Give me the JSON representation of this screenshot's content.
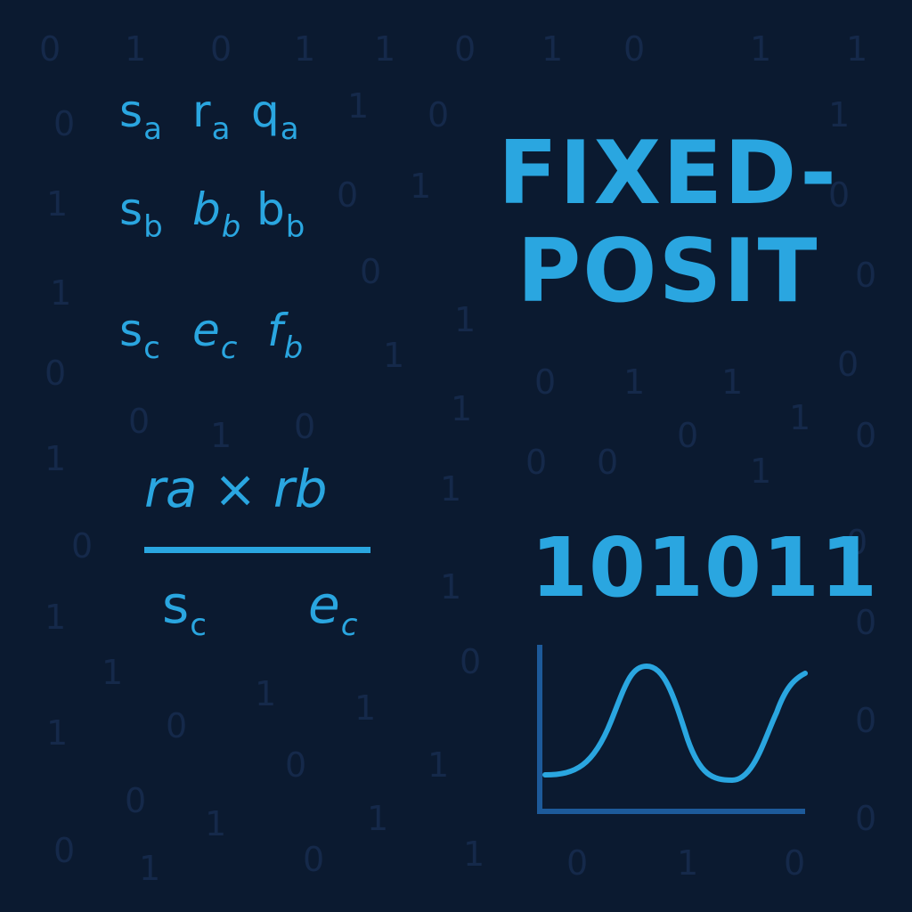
{
  "symbols": {
    "row1": [
      {
        "main": "s",
        "sub": "a"
      },
      {
        "main": "r",
        "sub": "a"
      },
      {
        "main": "q",
        "sub": "a"
      }
    ],
    "row2": [
      {
        "main": "s",
        "sub": "b"
      },
      {
        "main": "b",
        "sub": "b"
      },
      {
        "main": "b",
        "sub": "b"
      }
    ],
    "row3": [
      {
        "main": "s",
        "sub": "c"
      },
      {
        "main": "e",
        "sub": "c"
      },
      {
        "main": "f",
        "sub": "b"
      }
    ]
  },
  "formula": {
    "numerator": "ra × rb",
    "denominator": [
      {
        "main": "s",
        "sub": "c"
      },
      {
        "main": "e",
        "sub": "c"
      }
    ]
  },
  "title": {
    "line1": "FIXED-",
    "line2": "POSIT"
  },
  "binary": "101011",
  "background_digits": [
    "0",
    "1",
    "0",
    "1",
    "1",
    "0",
    "1",
    "0",
    "1",
    "1",
    "0",
    "1",
    "0",
    "1",
    "1",
    "0",
    "1",
    "0",
    "1",
    "0",
    "1",
    "0",
    "0",
    "1",
    "0",
    "1",
    "1",
    "0",
    "0",
    "1",
    "0",
    "1",
    "0",
    "1",
    "0",
    "1",
    "0",
    "0",
    "1",
    "0",
    "1",
    "0",
    "1",
    "1",
    "0",
    "1",
    "1",
    "0",
    "0",
    "1",
    "0",
    "1",
    "0",
    "1",
    "0",
    "1",
    "1",
    "0",
    "0",
    "1",
    "0",
    "1",
    "0",
    "1"
  ],
  "colors": {
    "background": "#0b1a30",
    "accent": "#2aa6e0",
    "axis": "#1d5a9a",
    "digits": "#15294a"
  },
  "icons": {
    "chart": "sine-wave-chart-icon"
  }
}
